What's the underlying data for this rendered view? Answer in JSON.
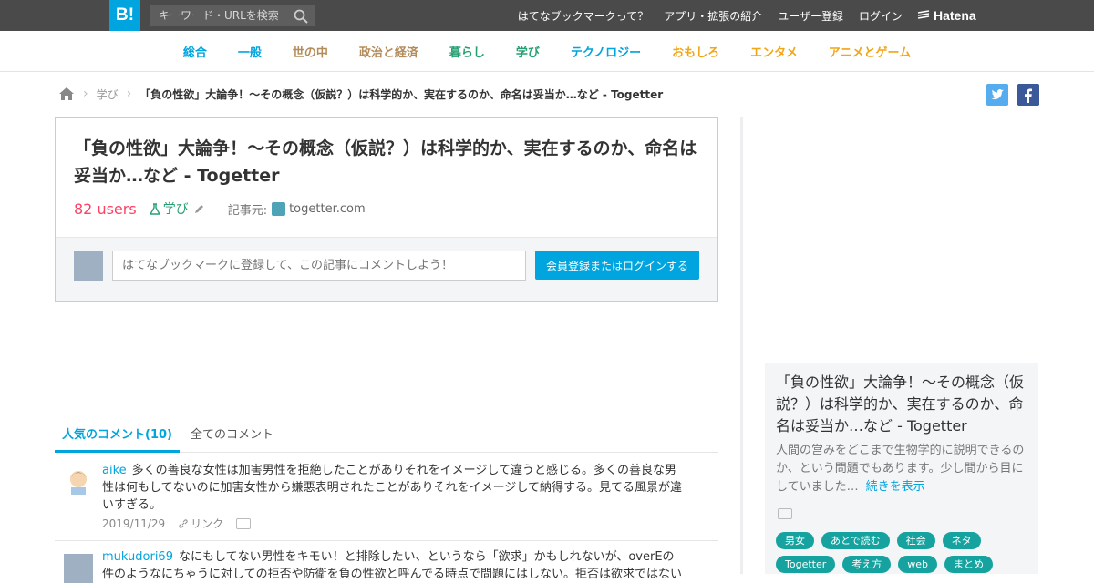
{
  "topbar": {
    "logo": "B!",
    "search_placeholder": "キーワード・URLを検索",
    "links": [
      "はてなブックマークって？",
      "アプリ・拡張の紹介",
      "ユーザー登録",
      "ログイン"
    ],
    "brand": "Hatena"
  },
  "categories": [
    {
      "label": "総合",
      "color": "#00a4de"
    },
    {
      "label": "一般",
      "color": "#00a4de"
    },
    {
      "label": "世の中",
      "color": "#b48c5a"
    },
    {
      "label": "政治と経済",
      "color": "#b48c5a"
    },
    {
      "label": "暮らし",
      "color": "#26a072"
    },
    {
      "label": "学び",
      "color": "#26a072"
    },
    {
      "label": "テクノロジー",
      "color": "#00a4de"
    },
    {
      "label": "おもしろ",
      "color": "#f2a515"
    },
    {
      "label": "エンタメ",
      "color": "#f2a515"
    },
    {
      "label": "アニメとゲーム",
      "color": "#f2a515"
    }
  ],
  "breadcrumb": {
    "category": "学び",
    "current": "「負の性欲」大論争！～その概念（仮説？）は科学的か、実在するのか、命名は妥当か…など - Togetter"
  },
  "entry": {
    "title": "「負の性欲」大論争！～その概念（仮説？）は科学的か、実在するのか、命名は妥当か…など - Togetter",
    "users": "82 users",
    "category": "学び",
    "source_label": "記事元:",
    "source": "togetter.com",
    "comment_placeholder": "はてなブックマークに登録して、この記事にコメントしよう！",
    "login_button": "会員登録またはログインする"
  },
  "tabs": {
    "popular": "人気のコメント(10)",
    "all": "全てのコメント"
  },
  "comments": [
    {
      "user": "aike",
      "text": "多くの善良な女性は加害男性を拒絶したことがありそれをイメージして違うと感じる。多くの善良な男性は何もしてないのに加害女性から嫌悪表明されたことがありそれをイメージして納得する。見てる風景が違いすぎる。",
      "date": "2019/11/29",
      "link": "リンク"
    },
    {
      "user": "mukudori69",
      "text": "なにもしてない男性をキモい！と排除したい、というなら「欲求」かもしれないが、overEの件のようなにちゃうに対しての拒否や防衛を負の性欲と呼んでる時点で問題にはしない。拒否は欲求ではない",
      "date": "",
      "link": ""
    }
  ],
  "sidebar": {
    "title": "「負の性欲」大論争！～その概念（仮説？）は科学的か、実在するのか、命名は妥当か…など - Togetter",
    "desc": "人間の営みをどこまで生物学的に説明できるのか、という問題でもあります。少し間から目にしていました…",
    "more": "続きを表示",
    "tags": [
      "男女",
      "あとで読む",
      "社会",
      "ネタ",
      "Togetter",
      "考え方",
      "web",
      "まとめ"
    ]
  }
}
